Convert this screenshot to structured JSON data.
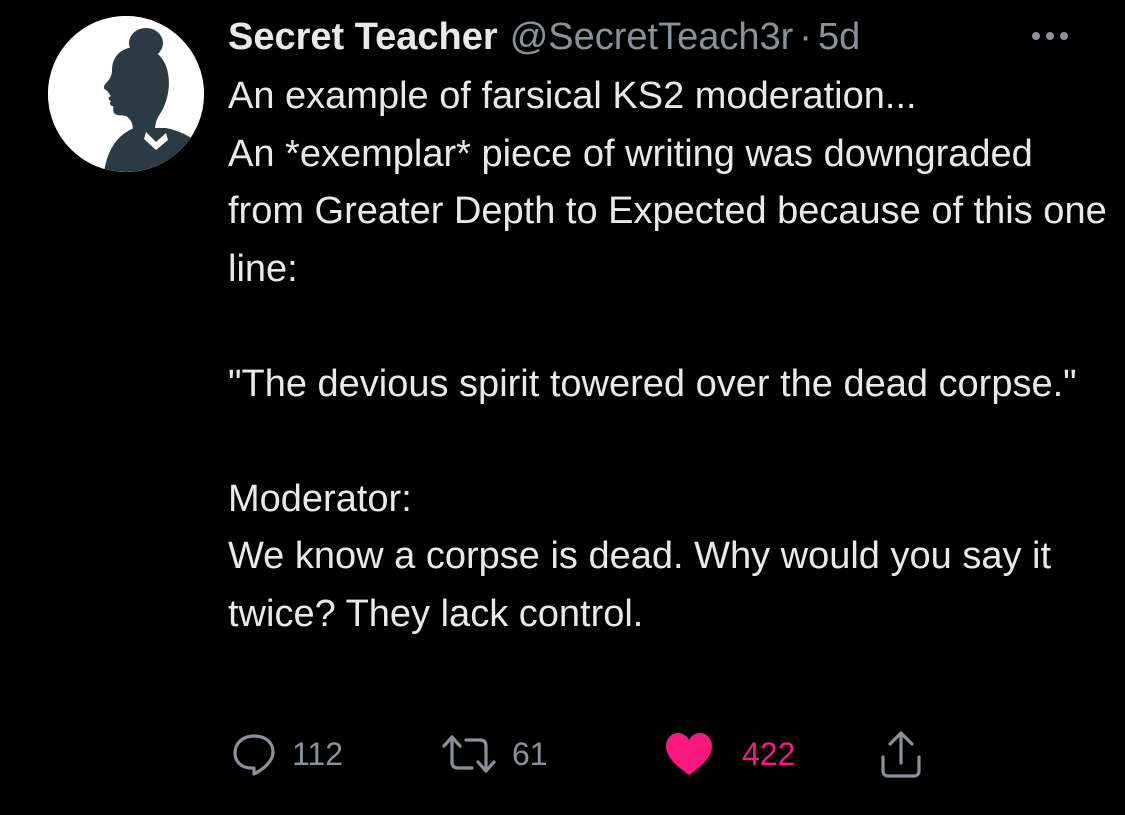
{
  "colors": {
    "background": "#000000",
    "text": "#e7e9ea",
    "secondary": "#8b9198",
    "like": "#f91880",
    "avatar_bg": "#ffffff",
    "avatar_silhouette": "#2c3a44"
  },
  "tweet": {
    "author": {
      "display_name": "Secret Teacher",
      "handle": "@SecretTeach3r",
      "avatar_icon": "silhouette-avatar"
    },
    "separator": "·",
    "time": "5d",
    "more_icon": "more-horizontal-icon",
    "paragraphs": [
      "An example of farsical KS2 moderation...\nAn *exemplar* piece of writing was downgraded from Greater Depth to Expected because of this one line:",
      "\"The devious spirit towered over the dead corpse.\"",
      "Moderator:\nWe know a corpse is dead. Why would you say it twice? They lack control."
    ],
    "actions": {
      "reply": {
        "icon": "reply-icon",
        "count": "112"
      },
      "retweet": {
        "icon": "retweet-icon",
        "count": "61"
      },
      "like": {
        "icon": "heart-filled-icon",
        "count": "422",
        "liked": true
      },
      "share": {
        "icon": "share-icon"
      }
    }
  }
}
